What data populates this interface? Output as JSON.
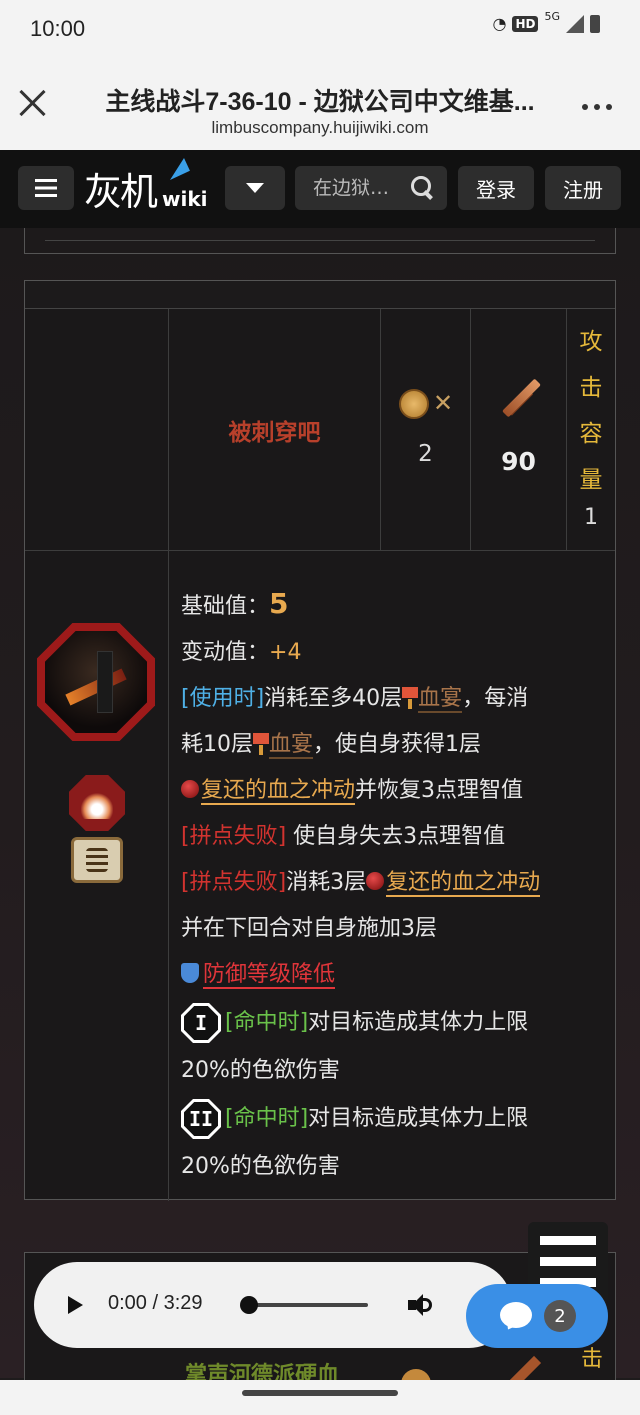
{
  "status_bar": {
    "time": "10:00",
    "hd": "HD",
    "network": "5G"
  },
  "browser": {
    "title": "主线战斗7-36-10 - 边狱公司中文维基...",
    "url": "limbuscompany.huijiwiki.com"
  },
  "site_nav": {
    "logo_text": "灰机",
    "logo_suffix": "wiki",
    "search_placeholder": "在边狱…",
    "login": "登录",
    "register": "注册"
  },
  "skill": {
    "name": "被刺穿吧",
    "coin_count": "2",
    "power": "90",
    "attack_capacity_label": [
      "攻",
      "击",
      "容",
      "量"
    ],
    "attack_capacity_value": "1",
    "base_label": "基础值：",
    "base_value": "5",
    "var_label": "变动值：",
    "var_value": "+4",
    "desc": {
      "on_use_tag": "[使用时]",
      "t1": "消耗至多40层",
      "bloodfeast": "血宴",
      "t2": "，每消",
      "t3": "耗10层",
      "t4": "，使自身获得1层",
      "revenant": "复还的血之冲动",
      "t5": "并恢复3点理智值",
      "clash_lose_tag": "[拼点失败]",
      "t6": " 使自身失去3点理智值",
      "t7": "消耗3层",
      "t8": "并在下回合对自身施加3层",
      "defense_down": "防御等级降低",
      "coin1": "I",
      "coin2": "II",
      "on_hit_tag": "[命中时]",
      "t9": "对目标造成其体力上限",
      "t10": "20%的色欲伤害"
    }
  },
  "next_skill": {
    "name": "掌声河德派硬血",
    "capacity_char": "击"
  },
  "audio": {
    "time": "0:00 / 3:29",
    "progress": 0
  },
  "chat": {
    "count": "2"
  }
}
